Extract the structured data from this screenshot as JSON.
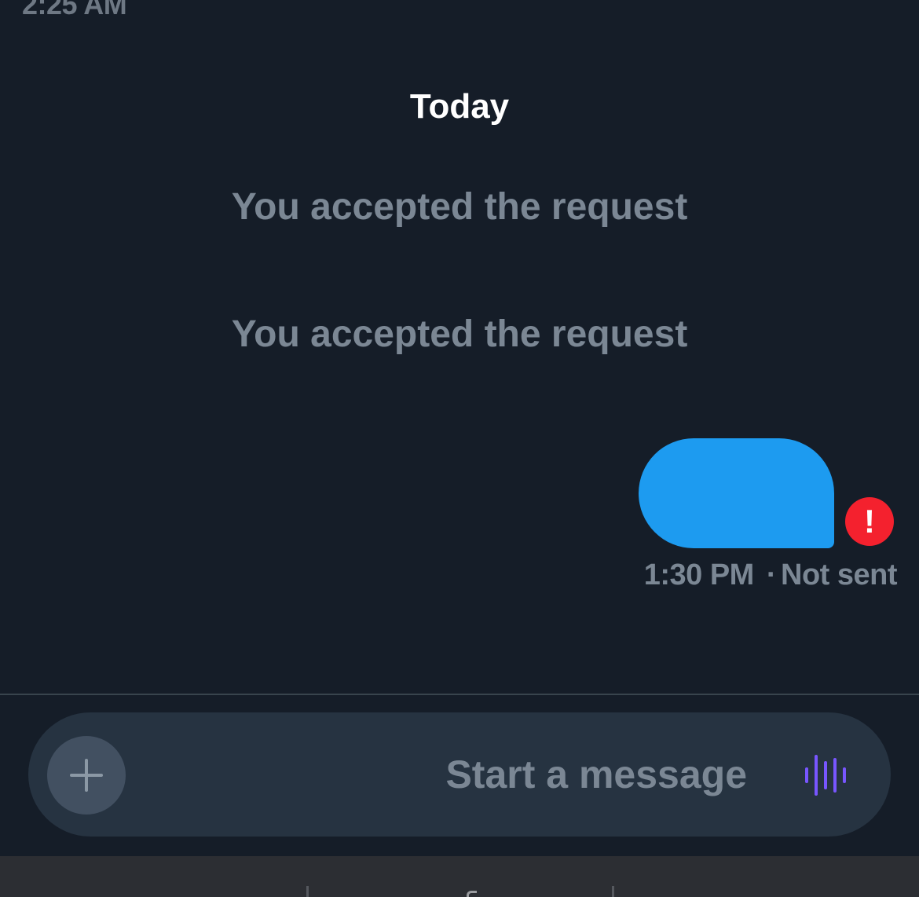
{
  "conversation": {
    "previous_timestamp": "2:25 AM",
    "date_header": "Today",
    "system_messages": [
      "You accepted the request",
      "You accepted the request"
    ],
    "sent_message": {
      "bubble_color": "#1d9bf0",
      "error_icon": "exclamation-icon",
      "error_glyph": "!",
      "time": "1:30 PM",
      "separator": "·",
      "status": "Not sent"
    }
  },
  "composer": {
    "placeholder": "Start a message",
    "value": "",
    "add_icon": "plus-icon",
    "voice_icon": "voice-waveform-icon"
  },
  "colors": {
    "background": "#151d28",
    "accent": "#1d9bf0",
    "error": "#f4212e",
    "voice": "#7856ff"
  }
}
